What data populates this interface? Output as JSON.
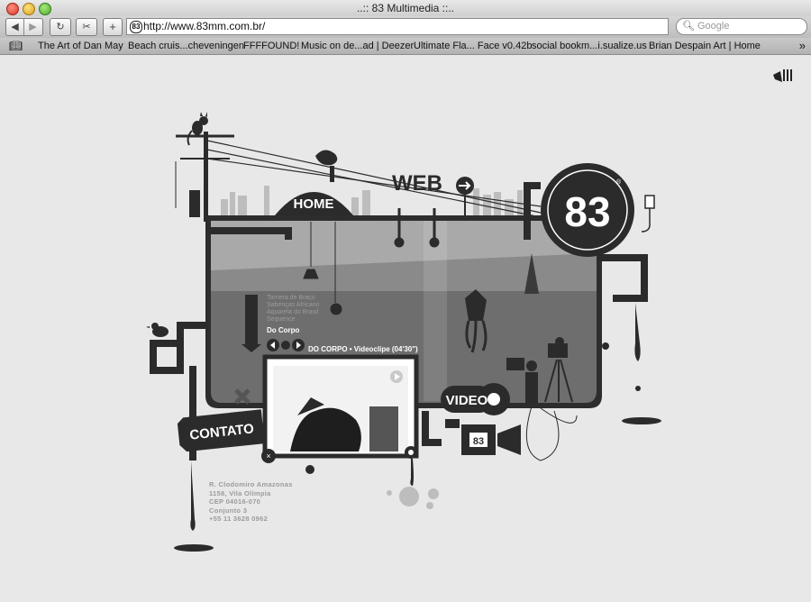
{
  "window": {
    "title": "..:: 83 Multimedia ::.."
  },
  "toolbar": {
    "back_icon": "back-arrow-icon",
    "forward_icon": "forward-arrow-icon",
    "reload_icon": "reload-icon",
    "add_icon": "plus-icon",
    "address_value": "http://www.83mm.com.br/",
    "favicon": "83",
    "search_placeholder": "Google"
  },
  "bookmarks": {
    "items": [
      "The Art of Dan May",
      "Beach cruis...cheveningen",
      "FFFFOUND!",
      "Music on de...ad | Deezer",
      "Ultimate Fla... Face v0.42b",
      "social bookm...i.sualize.us",
      "Brian Despain Art | Home"
    ],
    "more": "»"
  },
  "site": {
    "logo": "83",
    "logo_mark": "®",
    "nav": {
      "home": "HOME",
      "web": "WEB",
      "video": "VIDEO",
      "contact": "CONTATO"
    },
    "projects": [
      "Tornera de Braço",
      "Sabenças Africano",
      "Aquarela do Brasil",
      "Sequence"
    ],
    "current_project": "Do Corpo",
    "player_caption": "DO CORPO • Videoclipe (04'30\")",
    "address_lines": [
      "R. Clodomiro Amazonas",
      "1158, Vila Olímpia",
      "CEP 04016-070",
      "Conjunto 3",
      "+55 11 3628 0962"
    ],
    "colors": {
      "dark": "#2b2b2b",
      "tank": "#7a7a7a",
      "bg": "#e8e8e8"
    }
  }
}
